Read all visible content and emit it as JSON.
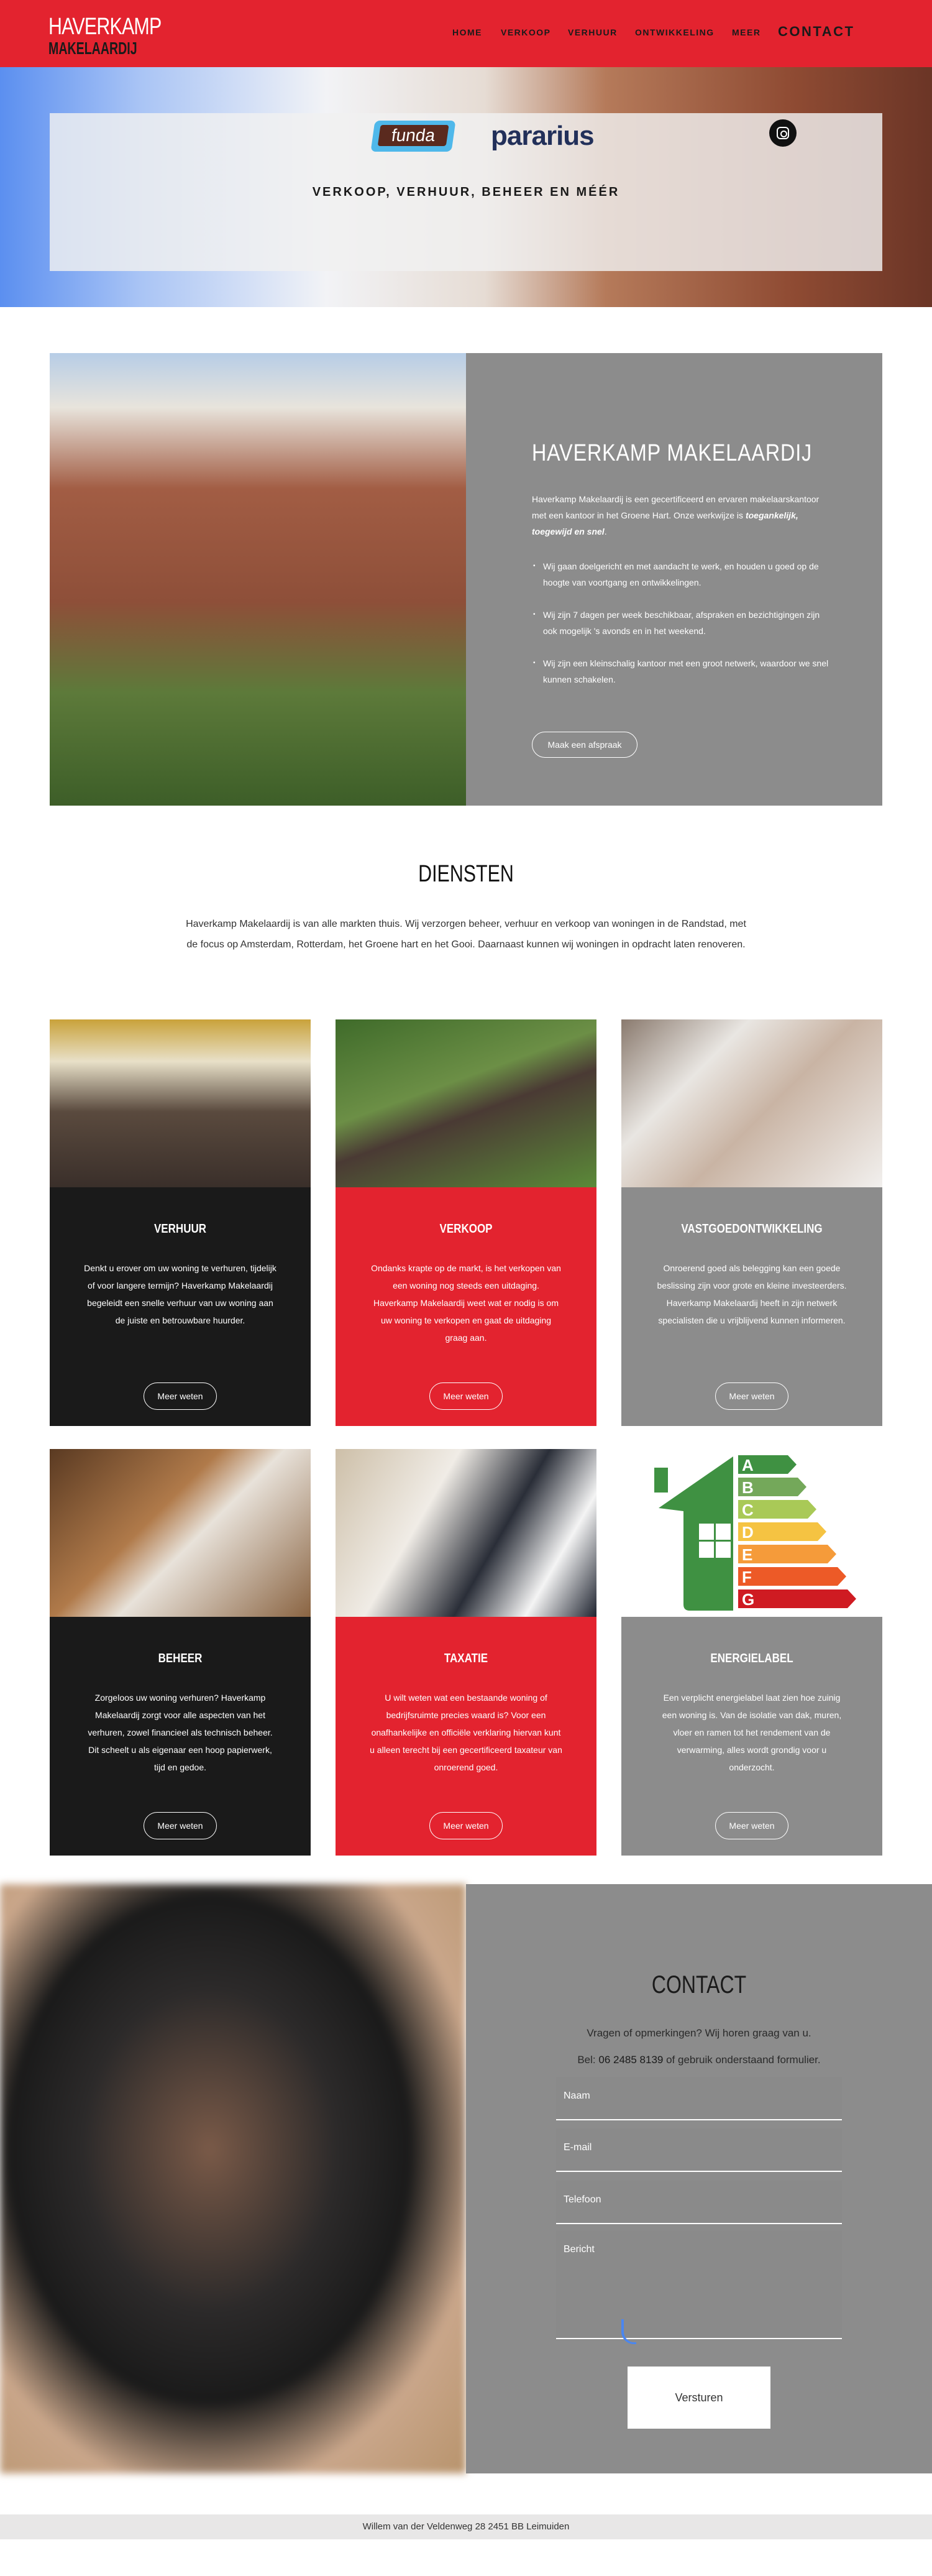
{
  "header": {
    "logo_line1": "HAVERKAMP",
    "logo_line2": "MAKELAARDIJ",
    "nav": [
      "HOME",
      "VERKOOP",
      "VERHUUR",
      "ONTWIKKELING",
      "MEER",
      "CONTACT"
    ],
    "brand_color": "#e3232f"
  },
  "hero": {
    "funda": "funda",
    "pararius": "pararius",
    "instagram_icon": "instagram-icon",
    "tagline": "VERKOOP, VERHUUR, BEHEER EN MÉÉR"
  },
  "about": {
    "title": "HAVERKAMP MAKELAARDIJ",
    "intro": "Haverkamp Makelaardij is een gecertificeerd en ervaren makelaarskantoor met een kantoor in het Groene Hart. Onze werkwijze is ",
    "intro_emph": "toegankelijk, toegewijd en snel",
    "intro_end": ".",
    "bullets": [
      "Wij gaan doelgericht en met aandacht te werk, en houden u goed op de hoogte van voortgang en ontwikkelingen.",
      "Wij zijn 7 dagen per week beschikbaar, afspraken en bezichtigingen zijn ook mogelijk 's avonds en in het weekend.",
      "Wij zijn een kleinschalig kantoor met een groot netwerk, waardoor we snel kunnen schakelen."
    ],
    "button": "Maak een afspraak"
  },
  "services": {
    "title": "DIENSTEN",
    "intro": "Haverkamp Makelaardij is van alle markten thuis. Wij verzorgen beheer, verhuur en verkoop van woningen in de Randstad, met de focus op Amsterdam, Rotterdam, het Groene hart en het Gooi. Daarnaast kunnen wij woningen in opdracht laten renoveren.",
    "cards": [
      {
        "title": "VERHUUR",
        "text": "Denkt u erover om uw woning te verhuren, tijdelijk of voor langere termijn? Haverkamp Makelaardij begeleidt een snelle verhuur van uw woning aan de juiste en betrouwbare huurder.",
        "button": "Meer weten"
      },
      {
        "title": "VERKOOP",
        "text": "Ondanks krapte op de markt, is het verkopen van een woning nog steeds een uitdaging. Haverkamp Makelaardij weet wat er nodig is om uw woning te verkopen en gaat de uitdaging graag aan.",
        "button": "Meer weten"
      },
      {
        "title": "VASTGOEDONTWIKKELING",
        "text": "Onroerend goed als belegging kan een goede beslissing zijn voor grote en kleine investeerders. Haverkamp Makelaardij heeft in zijn netwerk specialisten die u vrijblijvend kunnen informeren.",
        "button": "Meer weten"
      },
      {
        "title": "BEHEER",
        "text": "Zorgeloos uw woning verhuren? Haverkamp Makelaardij zorgt voor alle aspecten van het verhuren, zowel financieel als technisch beheer. Dit scheelt u als eigenaar een hoop papierwerk, tijd en gedoe.",
        "button": "Meer weten"
      },
      {
        "title": "TAXATIE",
        "text": "U wilt weten wat een bestaande woning of bedrijfsruimte precies waard is? Voor een onafhankelijke en officiële verklaring hiervan kunt u alleen terecht bij een gecertificeerd taxateur van onroerend goed.",
        "button": "Meer weten"
      },
      {
        "title": "ENERGIELABEL",
        "text": "Een verplicht energielabel laat zien hoe zuinig een woning is. Van de isolatie van dak, muren, vloer en ramen tot het rendement van de verwarming, alles wordt grondig voor u onderzocht.",
        "button": "Meer weten"
      }
    ],
    "energy_labels": [
      "A",
      "B",
      "C",
      "D",
      "E",
      "F",
      "G"
    ],
    "energy_colors": [
      "#3f9142",
      "#74a85a",
      "#a9c957",
      "#f5c342",
      "#f59b3a",
      "#ed5a27",
      "#cf1b22"
    ]
  },
  "contact": {
    "title": "CONTACT",
    "line1": "Vragen of opmerkingen? Wij horen graag van u.",
    "line2_pre": "Bel: ",
    "phone": "06 2485 8139",
    "line2_post": " of gebruik onderstaand formulier.",
    "fields": [
      "Naam",
      "E-mail",
      "Telefoon",
      "Bericht"
    ],
    "submit": "Versturen"
  },
  "footer": {
    "address": "Willem van der Veldenweg 28 2451 BB Leimuiden"
  }
}
